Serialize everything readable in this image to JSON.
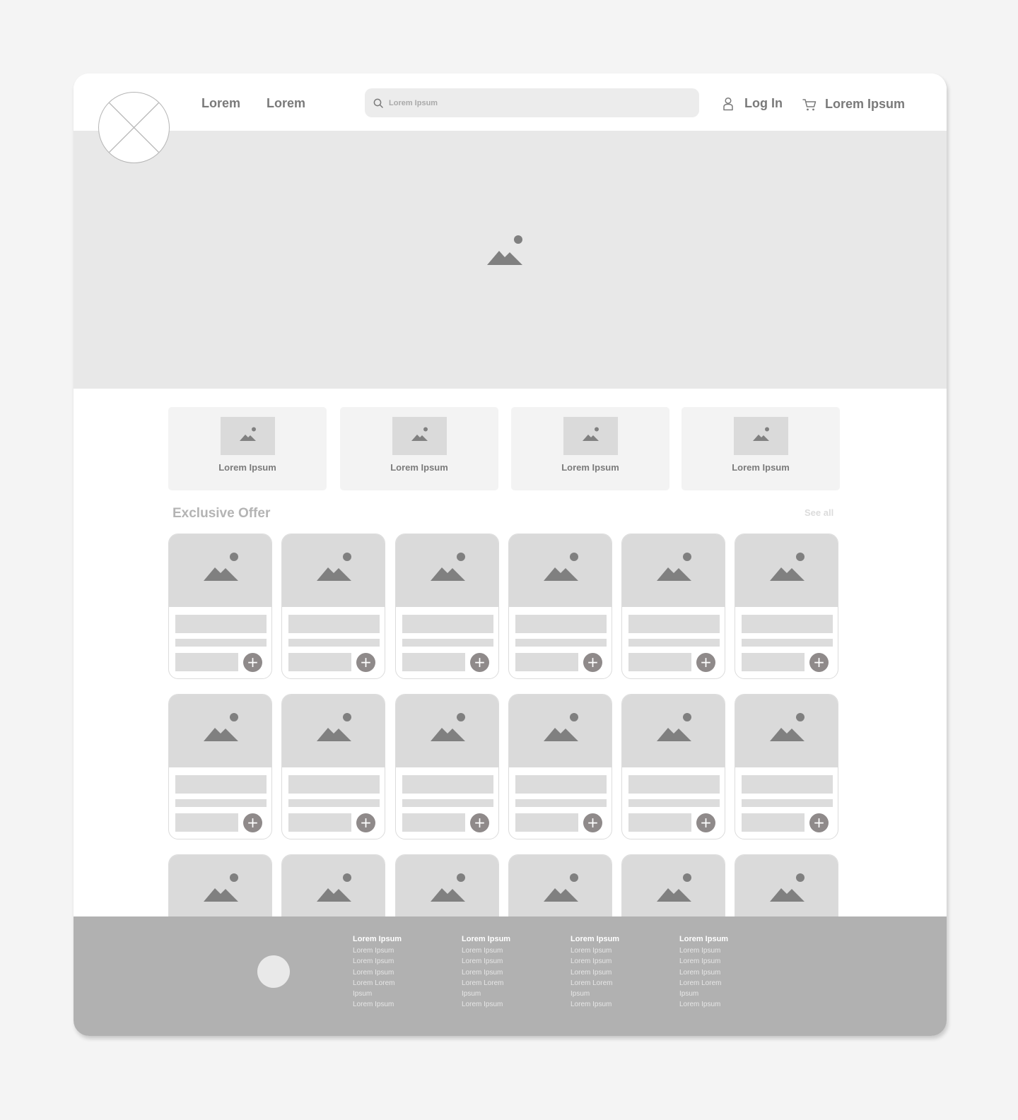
{
  "header": {
    "nav": [
      "Lorem",
      "Lorem"
    ],
    "search_placeholder": "Lorem Ipsum",
    "login_label": "Log In",
    "cart_label": "Lorem Ipsum"
  },
  "categories": [
    {
      "label": "Lorem Ipsum"
    },
    {
      "label": "Lorem Ipsum"
    },
    {
      "label": "Lorem Ipsum"
    },
    {
      "label": "Lorem Ipsum"
    }
  ],
  "section": {
    "title": "Exclusive Offer",
    "see_all": "See all"
  },
  "footer": {
    "columns": [
      {
        "title": "Lorem Ipsum",
        "items": [
          "Lorem Ipsum",
          "Lorem Ipsum",
          "Lorem Ipsum",
          "Lorem Lorem",
          "Ipsum",
          "Lorem Ipsum"
        ]
      },
      {
        "title": "Lorem Ipsum",
        "items": [
          "Lorem Ipsum",
          "Lorem Ipsum",
          "Lorem Ipsum",
          "Lorem Lorem",
          "Ipsum",
          "Lorem Ipsum"
        ]
      },
      {
        "title": "Lorem Ipsum",
        "items": [
          "Lorem Ipsum",
          "Lorem Ipsum",
          "Lorem Ipsum",
          "Lorem Lorem",
          "Ipsum",
          "Lorem Ipsum"
        ]
      },
      {
        "title": "Lorem Ipsum",
        "items": [
          "Lorem Ipsum",
          "Lorem Ipsum",
          "Lorem Ipsum",
          "Lorem Lorem",
          "Ipsum",
          "Lorem Ipsum"
        ]
      }
    ]
  },
  "icons": {
    "add": "+",
    "image_placeholder": "mountain-image-icon"
  },
  "colors": {
    "background": "#f4f4f4",
    "hero": "#e8e8e8",
    "placeholder": "#dadada",
    "icon": "#808080",
    "plus_button": "#8f8a8a",
    "footer": "#b1b1b1"
  }
}
